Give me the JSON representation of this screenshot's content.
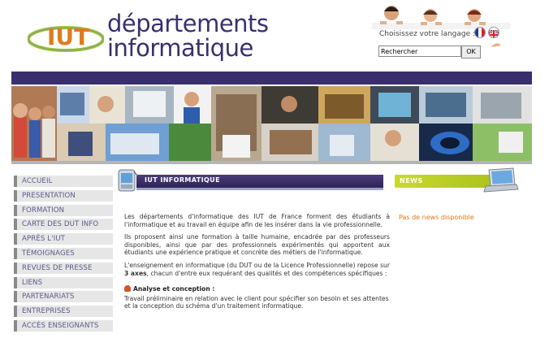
{
  "header": {
    "logo": {
      "badge_text": "IUT",
      "line1": "départements",
      "line2": "informatique"
    },
    "language": {
      "label": "Choisissez votre langage :",
      "flags": [
        "fr-flag",
        "uk-flag"
      ]
    },
    "search": {
      "value": "Rechercher",
      "button_label": "OK"
    }
  },
  "nav": {
    "items": [
      {
        "label": "ACCUEIL"
      },
      {
        "label": "PRESENTATION"
      },
      {
        "label": "FORMATION"
      },
      {
        "label": "CARTE DES DUT INFO"
      },
      {
        "label": "APRÈS L'IUT"
      },
      {
        "label": "TÉMOIGNAGES"
      },
      {
        "label": "REVUES DE PRESSE"
      },
      {
        "label": "LIENS"
      },
      {
        "label": "PARTENARIATS"
      },
      {
        "label": "ENTREPRISES"
      },
      {
        "label": "ACCÈS ENSEIGNANTS"
      }
    ]
  },
  "main": {
    "section_title": "IUT INFORMATIQUE",
    "paragraphs": [
      "Les départements d'informatique des IUT de France forment des étudiants à l'informatique et au travail en équipe afin de les insérer dans la vie professionnelle.",
      "Ils proposent ainsi une formation à taille humaine, encadrée par des professeurs disponibles, ainsi que par des professionnels expérimentés qui apportent aux étudiants une expérience pratique et concrète des métiers de l'informatique."
    ],
    "axes_intro_before": "L'enseignement en informatique (du DUT ou de la Licence Professionnelle) repose sur ",
    "axes_intro_bold": "3 axes",
    "axes_intro_after": ", chacun d'entre eux requérant des qualités et des compétences spécifiques :",
    "axis1_title": "Analyse et conception :",
    "axis1_text": "Travail préliminaire en relation avec le client pour spécifier son besoin et ses attentes et la conception du schéma d'un traitement informatique."
  },
  "news": {
    "title": "NEWS",
    "empty_text": "Pas de news disponible"
  },
  "colors": {
    "brand_purple": "#3a2f6e",
    "news_green": "#b4cc22",
    "news_orange": "#e0781e"
  }
}
